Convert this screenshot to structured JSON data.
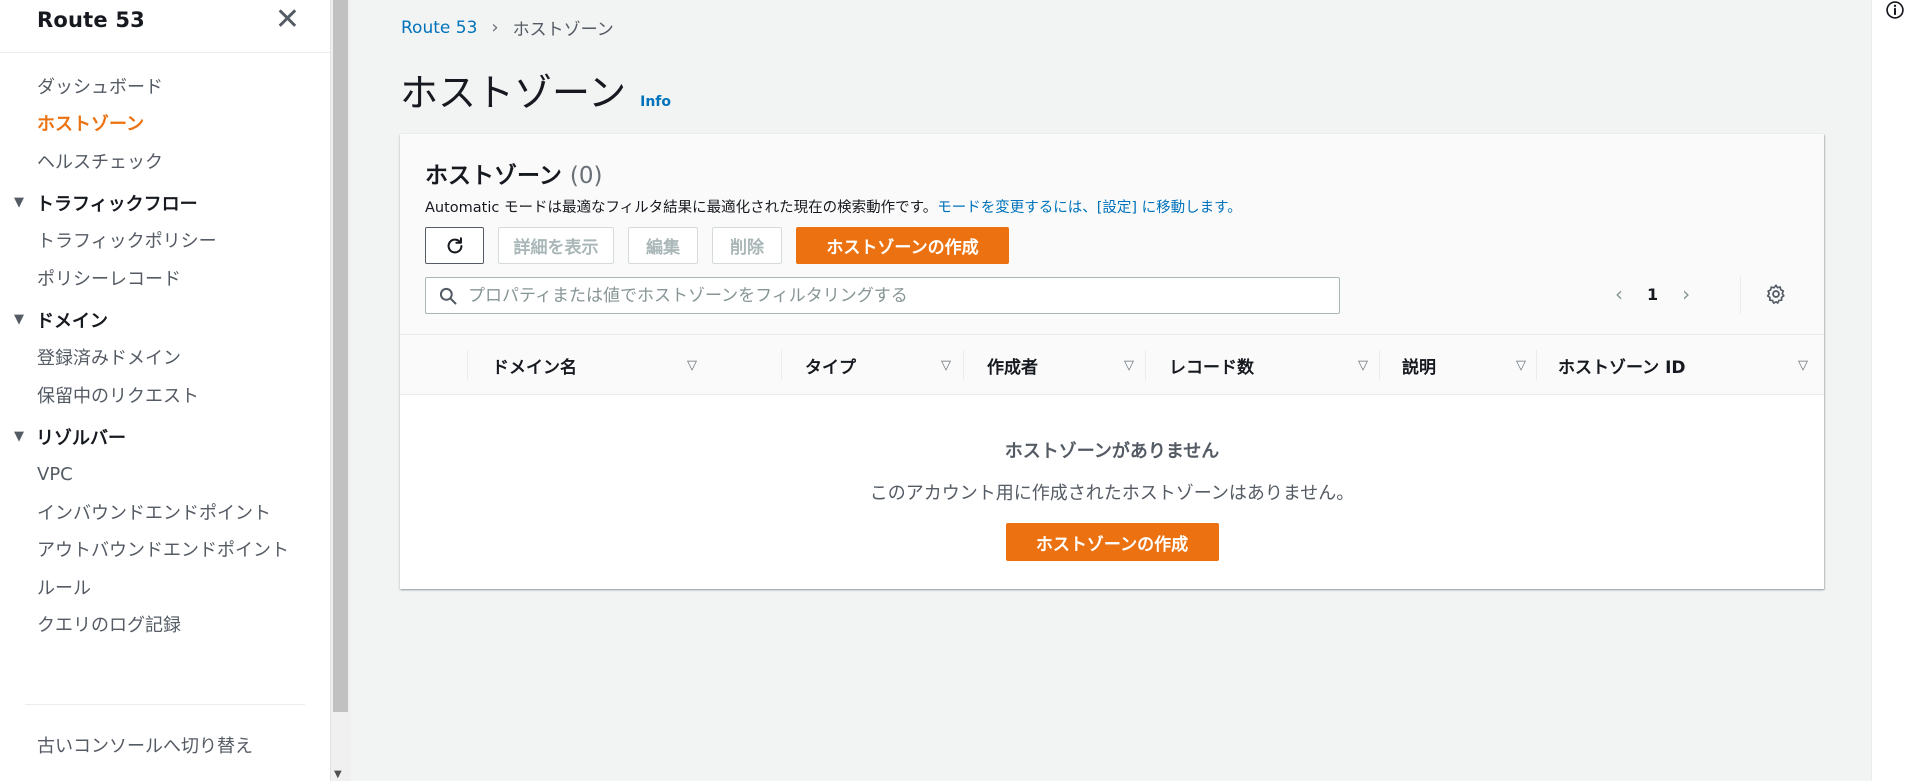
{
  "sidebar": {
    "title": "Route 53",
    "items_top": [
      {
        "label": "ダッシュボード"
      },
      {
        "label": "ホストゾーン"
      },
      {
        "label": "ヘルスチェック"
      }
    ],
    "sections": [
      {
        "label": "トラフィックフロー",
        "items": [
          {
            "label": "トラフィックポリシー"
          },
          {
            "label": "ポリシーレコード"
          }
        ]
      },
      {
        "label": "ドメイン",
        "items": [
          {
            "label": "登録済みドメイン"
          },
          {
            "label": "保留中のリクエスト"
          }
        ]
      },
      {
        "label": "リゾルバー",
        "items": [
          {
            "label": "VPC"
          },
          {
            "label": "インバウンドエンドポイント"
          },
          {
            "label": "アウトバウンドエンドポイント"
          },
          {
            "label": "ルール"
          },
          {
            "label": "クエリのログ記録"
          }
        ]
      }
    ],
    "footer": "古いコンソールへ切り替え"
  },
  "breadcrumb": {
    "root": "Route 53",
    "current": "ホストゾーン"
  },
  "page": {
    "title": "ホストゾーン",
    "info": "Info"
  },
  "container": {
    "title": "ホストゾーン",
    "count": "(0)",
    "desc_prefix": "Automatic モードは最適なフィルタ結果に最適化された現在の検索動作です。",
    "desc_link": "モードを変更するには、[設定] に移動します。"
  },
  "toolbar": {
    "details": "詳細を表示",
    "edit": "編集",
    "delete": "削除",
    "create": "ホストゾーンの作成"
  },
  "search": {
    "placeholder": "プロパティまたは値でホストゾーンをフィルタリングする"
  },
  "pagination": {
    "page": "1"
  },
  "table": {
    "columns": [
      "ドメイン名",
      "タイプ",
      "作成者",
      "レコード数",
      "説明",
      "ホストゾーン ID"
    ]
  },
  "empty": {
    "title": "ホストゾーンがありません",
    "subtitle": "このアカウント用に作成されたホストゾーンはありません。",
    "button": "ホストゾーンの作成"
  },
  "colors": {
    "accent": "#ec7211",
    "link": "#0073bb"
  }
}
